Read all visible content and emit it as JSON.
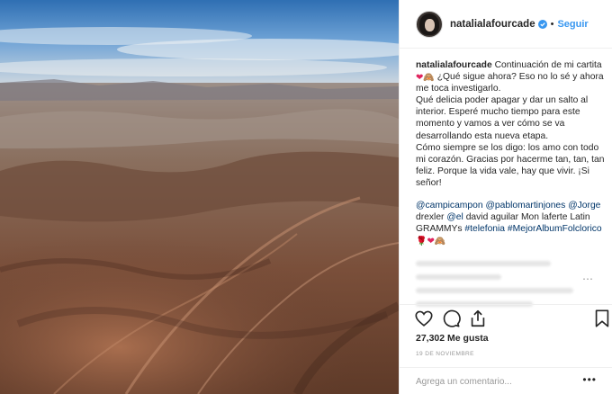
{
  "header": {
    "username": "natalialafourcade",
    "separator": "•",
    "follow_label": "Seguir"
  },
  "caption": {
    "username": "natalialafourcade",
    "line1_text": "Continuación de mi cartita",
    "line1_after": "¿Qué sigue ahora? Eso no lo sé y ahora me toca investigarlo.",
    "para2": "Qué delicia poder apagar y dar un salto al interior. Esperé mucho tiempo para este momento y vamos a ver cómo se va desarrollando esta nueva etapa.",
    "para3": "Cómo siempre se los digo: los amo con todo mi corazón. Gracias por hacerme tan, tan, tan feliz. Porque la vida vale, hay que vivir. ¡Si señor!",
    "mention1": "@campicampon",
    "mention2": "@pablomartinjones",
    "mention3": "@Jorge",
    "text_a": "drexler",
    "mention4": "@el",
    "text_b": "david aguilar Mon laferte Latin GRAMMYs",
    "hashtag1": "#telefonia",
    "hashtag2": "#MejorAlbumFolclorico"
  },
  "icons": {
    "heart": "heart-icon",
    "comment": "comment-icon",
    "share": "share-icon",
    "bookmark": "bookmark-icon",
    "verified": "verified-badge-icon"
  },
  "likes_text": "27,302 Me gusta",
  "date_text": "19 DE NOVIEMBRE",
  "comment": {
    "placeholder": "Agrega un comentario...",
    "more_label": "•••"
  },
  "colors": {
    "link": "#003569",
    "follow": "#3897f0",
    "verified": "#3897f0",
    "heart_emoji": "#e0245e"
  }
}
